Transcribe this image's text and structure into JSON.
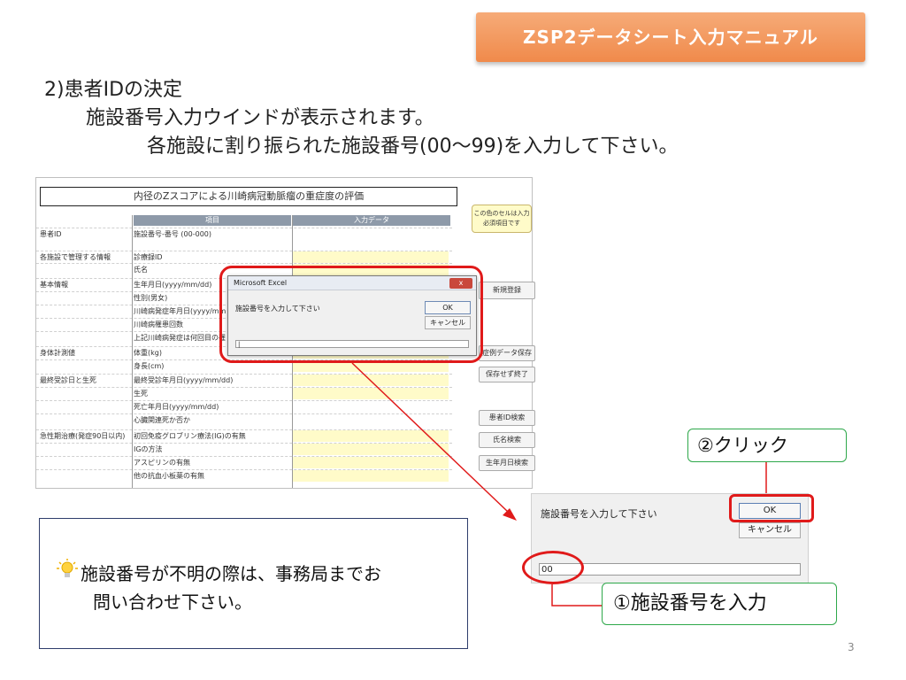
{
  "banner": {
    "title": "ZSP2データシート入力マニュアル"
  },
  "step": {
    "heading": "2)患者IDの決定",
    "line1": "施設番号入力ウインドが表示されます。",
    "line2": "各施設に割り振られた施設番号(00～99)を入力して下さい。"
  },
  "sheet": {
    "title": "内径のZスコアによる川崎病冠動脈瘤の重症度の評価",
    "col_item": "項目",
    "col_input": "入力データ",
    "callout": "この色のセルは入力必須項目です",
    "rows": [
      {
        "cat": "患者ID",
        "item": "施設番号-番号 (00-000)"
      },
      {
        "cat": "各施設で管理する情報",
        "item": "診療録ID"
      },
      {
        "cat": "",
        "item": "氏名"
      },
      {
        "cat": "基本情報",
        "item": "生年月日(yyyy/mm/dd)"
      },
      {
        "cat": "",
        "item": "性別(男女)"
      },
      {
        "cat": "",
        "item": "川崎病発症年月日(yyyy/mm"
      },
      {
        "cat": "",
        "item": "川崎病罹患回数"
      },
      {
        "cat": "",
        "item": "上記川崎病発症は何回目の罹"
      },
      {
        "cat": "身体計測値",
        "item": "体重(kg)"
      },
      {
        "cat": "",
        "item": "身長(cm)"
      },
      {
        "cat": "最終受診日と生死",
        "item": "最終受診年月日(yyyy/mm/dd)"
      },
      {
        "cat": "",
        "item": "生死"
      },
      {
        "cat": "",
        "item": "死亡年月日(yyyy/mm/dd)"
      },
      {
        "cat": "",
        "item": "心臓関連死か否か"
      },
      {
        "cat": "急性期治療(発症90日以内)",
        "item": "初回免疫グロブリン療法(IG)の有無"
      },
      {
        "cat": "",
        "item": "IGの方法"
      },
      {
        "cat": "",
        "item": "アスピリンの有無"
      },
      {
        "cat": "",
        "item": "他の抗血小板薬の有無"
      }
    ],
    "buttons": {
      "new": "新規登録",
      "save": "症例データ保存",
      "quit": "保存せず終了",
      "search_id": "患者ID検索",
      "search_name": "氏名検索",
      "search_dob": "生年月日検索"
    }
  },
  "dialog_small": {
    "title": "Microsoft Excel",
    "close": "x",
    "message": "施設番号を入力して下さい",
    "ok": "OK",
    "cancel": "キャンセル",
    "value": "|"
  },
  "dialog_zoom": {
    "message": "施設番号を入力して下さい",
    "ok": "OK",
    "cancel": "キャンセル",
    "value": "00"
  },
  "labels": {
    "click": "②クリック",
    "enter": "①施設番号を入力"
  },
  "note": {
    "line1": "施設番号が不明の際は、事務局までお",
    "line2": "問い合わせ下さい。"
  },
  "page_number": "3",
  "colors": {
    "accent_orange": "#f08a4b",
    "highlight_red": "#e01a1a",
    "label_green": "#2ea84a",
    "input_yellow": "#fffbc9"
  }
}
